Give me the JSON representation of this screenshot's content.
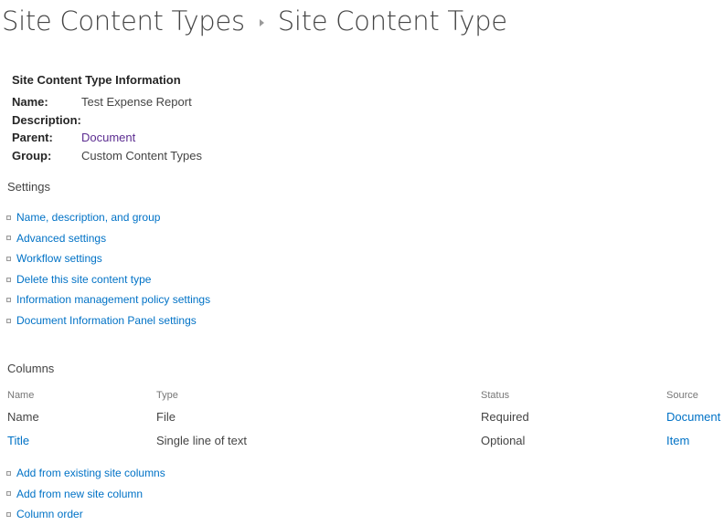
{
  "breadcrumb": {
    "parent": "Site Content Types",
    "current": "Site Content Type"
  },
  "info": {
    "heading": "Site Content Type Information",
    "name_label": "Name:",
    "name_value": "Test Expense Report",
    "description_label": "Description:",
    "description_value": "",
    "parent_label": "Parent:",
    "parent_value": "Document",
    "group_label": "Group:",
    "group_value": "Custom Content Types"
  },
  "settings": {
    "title": "Settings",
    "links": [
      "Name, description, and group",
      "Advanced settings",
      "Workflow settings",
      "Delete this site content type",
      "Information management policy settings",
      "Document Information Panel settings"
    ]
  },
  "columns": {
    "title": "Columns",
    "headers": [
      "Name",
      "Type",
      "Status",
      "Source"
    ],
    "rows": [
      [
        "Name",
        "File",
        "Required",
        "Document"
      ],
      [
        "Title",
        "Single line of text",
        "Optional",
        "Item"
      ]
    ],
    "links": [
      "Add from existing site columns",
      "Add from new site column",
      "Column order"
    ]
  },
  "colors": {
    "link": "#0072c6",
    "visited_link": "#5c2d91",
    "text": "#444444"
  }
}
